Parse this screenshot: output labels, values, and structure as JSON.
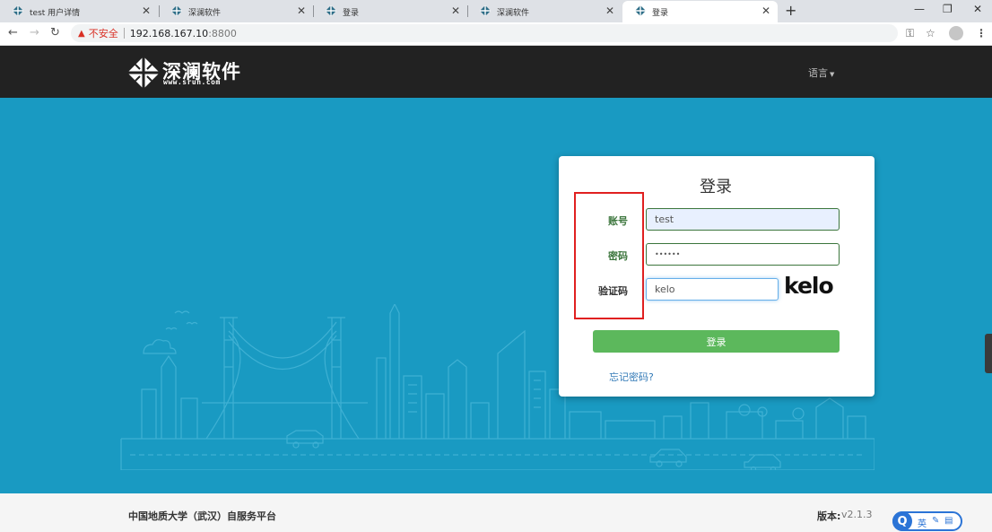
{
  "browser": {
    "tabs": [
      {
        "title": "test 用户详情",
        "active": false
      },
      {
        "title": "深澜软件",
        "active": false
      },
      {
        "title": "登录",
        "active": false
      },
      {
        "title": "深澜软件",
        "active": false
      },
      {
        "title": "登录",
        "active": true
      }
    ],
    "new_tab": "+",
    "url": {
      "security_label": "不安全",
      "host": "192.168.167.10",
      "port": ":8800"
    }
  },
  "header": {
    "brand": "深澜软件",
    "brand_url": "www.srun.com",
    "language_menu": "语言"
  },
  "login": {
    "title": "登录",
    "account_label": "账号",
    "account_value": "test",
    "password_label": "密码",
    "password_value": "••••••",
    "captcha_label": "验证码",
    "captcha_value": "kelo",
    "captcha_image_text": "kelo",
    "submit_label": "登录",
    "forgot_link": "忘记密码?"
  },
  "footer": {
    "school": "中国地质大学（武汉）自服务平台",
    "version_label": "版本:",
    "version_value": "v2.1.3"
  },
  "ime": {
    "logo": "Q",
    "language": "英"
  },
  "colors": {
    "hero_background": "#199ac2",
    "header_background": "#222222",
    "login_button": "#5cb85c",
    "label_green": "#3c763d",
    "highlight_box": "#e02020",
    "link": "#337ab7"
  }
}
